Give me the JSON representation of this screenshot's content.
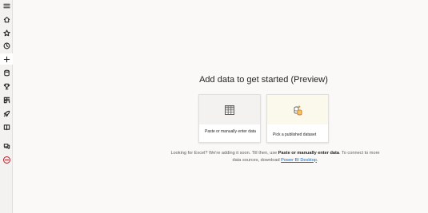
{
  "nav": {
    "items": [
      {
        "name": "menu-icon"
      },
      {
        "name": "home-icon"
      },
      {
        "name": "star-icon"
      },
      {
        "name": "clock-icon"
      },
      {
        "name": "plus-icon"
      },
      {
        "name": "cylinder-icon"
      },
      {
        "name": "trophy-icon"
      },
      {
        "name": "apps-icon"
      },
      {
        "name": "rocket-icon"
      },
      {
        "name": "book-icon"
      },
      {
        "name": "chat-icon"
      },
      {
        "name": "avatar-icon"
      }
    ]
  },
  "main": {
    "title": "Add data to get started (Preview)",
    "cards": [
      {
        "label": "Paste or manually enter data",
        "icon": "table-icon"
      },
      {
        "label": "Pick a published dataset",
        "icon": "dataset-icon"
      }
    ],
    "footer": {
      "part1": "Looking for Excel? We're adding it soon. Till then, use ",
      "strong": "Paste or manually enter data",
      "part2": ". To connect to more data sources, download ",
      "link": "Power BI Desktop",
      "part3": "."
    }
  },
  "colors": {
    "accent": "#0f6cbd",
    "dataset_accent": "#e8a33d"
  }
}
